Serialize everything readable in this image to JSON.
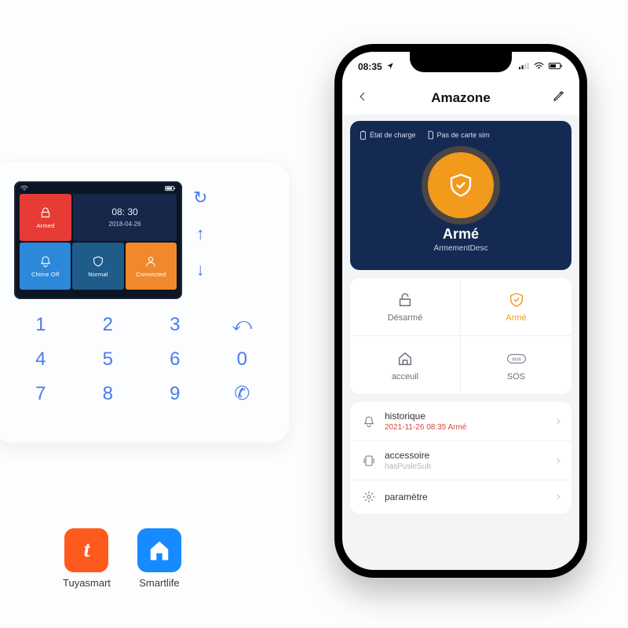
{
  "device_panel": {
    "status_time": "08: 30",
    "status_date": "2018-04-26",
    "tiles": {
      "armed": "Armed",
      "chime": "Chime Off",
      "normal": "Normal",
      "connected": "Connected"
    },
    "side_keys": {
      "sync": "↻",
      "up": "↑",
      "down": "↓"
    },
    "keypad": [
      "1",
      "2",
      "3",
      "⤺",
      "4",
      "5",
      "6",
      "0",
      "7",
      "8",
      "9",
      "✆"
    ]
  },
  "brands": {
    "tuya": {
      "glyph": "t",
      "label": "Tuyasmart"
    },
    "smartlife": {
      "label": "Smartlife"
    }
  },
  "phone": {
    "ios_time": "08:35",
    "app_title": "Amazone",
    "hero": {
      "charge_label": "État de charge",
      "sim_label": "Pas de carte sim",
      "title": "Armé",
      "subtitle": "ArmementDesc"
    },
    "actions": {
      "disarm": "Désarmé",
      "arm": "Armé",
      "home": "acceuil",
      "sos": "SOS"
    },
    "list": {
      "history_label": "historique",
      "history_sub": "2021-11-26 08:35 Armé",
      "accessory_label": "accessoire",
      "accessory_sub": "hasPusleSub",
      "settings_label": "paramètre"
    }
  }
}
